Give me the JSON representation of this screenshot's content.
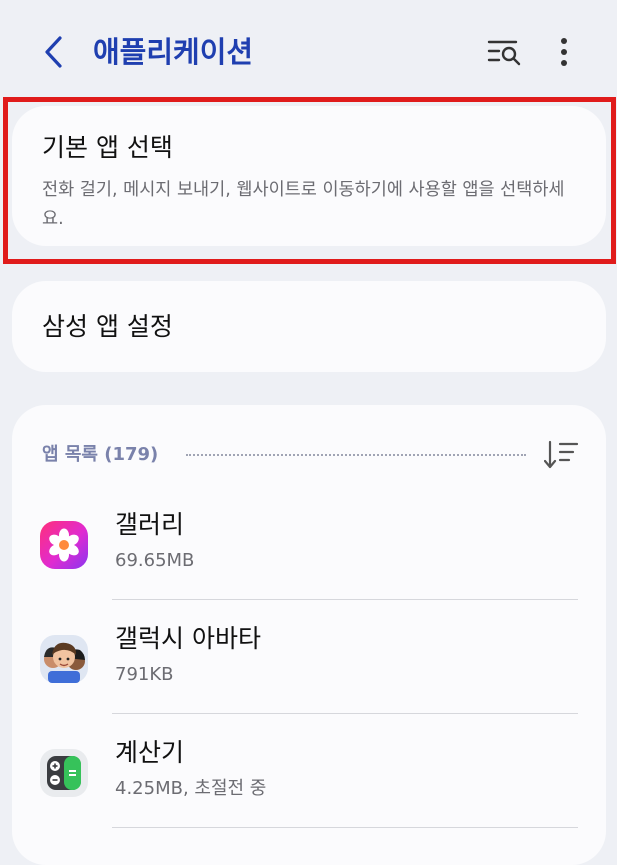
{
  "header": {
    "title": "애플리케이션",
    "back_icon": "chevron-left-icon",
    "search_icon": "list-search-icon",
    "more_icon": "more-vertical-icon",
    "accent_color": "#1f3fb0"
  },
  "default_apps": {
    "title": "기본 앱 선택",
    "description": "전화 걸기, 메시지 보내기, 웹사이트로 이동하기에 사용할 앱을 선택하세요."
  },
  "samsung_apps": {
    "title": "삼성 앱 설정"
  },
  "app_list": {
    "header": "앱 목록 (179)",
    "sort_icon": "sort-icon",
    "items": [
      {
        "name": "갤러리",
        "detail": "69.65MB",
        "icon": "gallery-icon"
      },
      {
        "name": "갤럭시 아바타",
        "detail": "791KB",
        "icon": "avatar-icon"
      },
      {
        "name": "계산기",
        "detail": "4.25MB, 초절전 중",
        "icon": "calculator-icon"
      }
    ]
  },
  "highlight_color": "#e01b1b"
}
